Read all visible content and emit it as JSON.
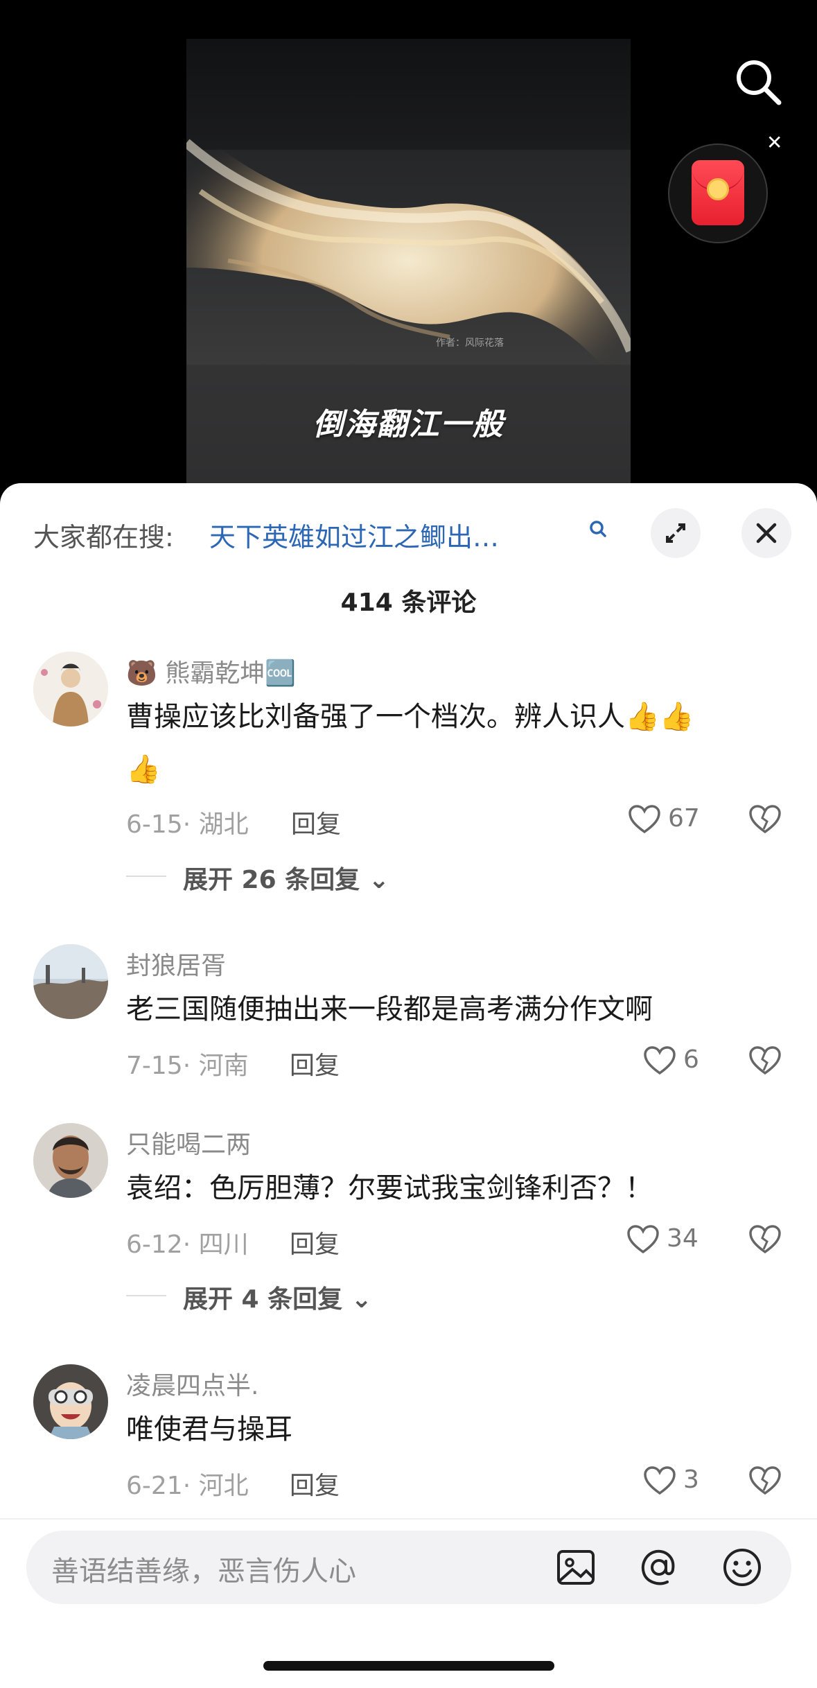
{
  "video": {
    "subtitle": "倒海翻江一般",
    "watermark": "作者：风际花落"
  },
  "top_icons": [
    "search-icon",
    "red-envelope-icon",
    "close-icon"
  ],
  "panel": {
    "trending_prefix": "大家都在搜:",
    "trending_query": "天下英雄如过江之鲫出…",
    "comment_count": "414 条评论"
  },
  "comments": [
    {
      "username": "🐻 熊霸乾坤🆒",
      "text": "曹操应该比刘备强了一个档次。辨人识人",
      "date_loc": "6-15· 湖北",
      "reply": "回复",
      "likes": "67",
      "expand": "展开 26 条回复"
    },
    {
      "username": "封狼居胥",
      "text": "老三国随便抽出来一段都是高考满分作文啊",
      "date_loc": "7-15· 河南",
      "reply": "回复",
      "likes": "6"
    },
    {
      "username": "只能喝二两",
      "text": "袁绍：色厉胆薄？尔要试我宝剑锋利否？！",
      "date_loc": "6-12· 四川",
      "reply": "回复",
      "likes": "34",
      "expand": "展开 4 条回复"
    },
    {
      "username": "凌晨四点半.",
      "text": "唯使君与操耳",
      "date_loc": "6-21· 河北",
      "reply": "回复",
      "likes": "3"
    }
  ],
  "input": {
    "placeholder": "善语结善缘，恶言伤人心",
    "icons": [
      "image-icon",
      "at-icon",
      "emoji-icon"
    ]
  },
  "colors": {
    "link_blue": "#2c67b5",
    "panel_bg": "#ffffff",
    "text_dark": "#1a1a1a",
    "text_gray": "#8a8a8a",
    "red_envelope": "#e8202f"
  }
}
